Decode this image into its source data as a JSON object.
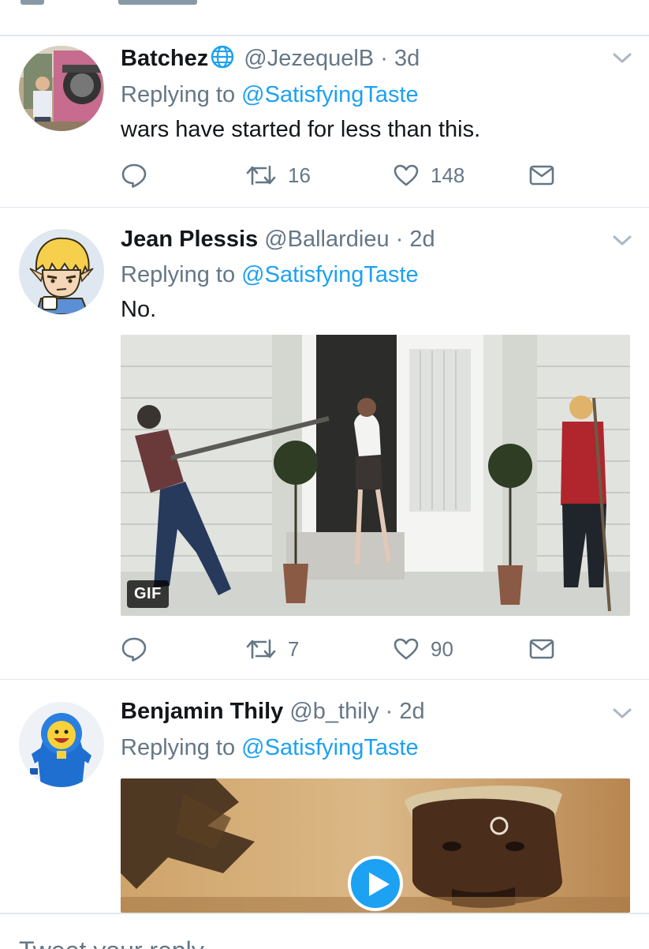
{
  "tweets": [
    {
      "name": "Batchez",
      "name_icon": "globe-icon",
      "handle": "@JezequelB",
      "separator": "·",
      "time": "3d",
      "replying_prefix": "Replying to ",
      "replying_to": "@SatisfyingTaste",
      "text": "wars have started for less than this.",
      "reply_count": "",
      "retweet_count": "16",
      "like_count": "148"
    },
    {
      "name": "Jean Plessis",
      "handle": "@Ballardieu",
      "separator": "·",
      "time": "2d",
      "replying_prefix": "Replying to ",
      "replying_to": "@SatisfyingTaste",
      "text": "No.",
      "media_badge": "GIF",
      "reply_count": "",
      "retweet_count": "7",
      "like_count": "90"
    },
    {
      "name": "Benjamin Thily",
      "handle": "@b_thily",
      "separator": "·",
      "time": "2d",
      "replying_prefix": "Replying to ",
      "replying_to": "@SatisfyingTaste",
      "media_icon": "play-icon"
    }
  ],
  "compose": {
    "placeholder": "Tweet your reply"
  },
  "colors": {
    "accent": "#1da1f2",
    "secondary_text": "#657786",
    "primary_text": "#14171a",
    "divider": "#e1e8ed"
  }
}
